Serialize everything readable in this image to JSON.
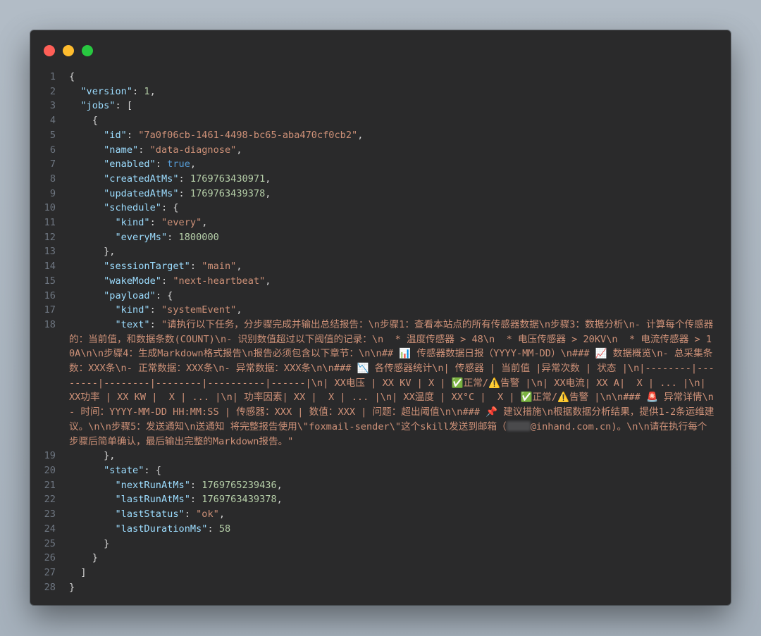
{
  "window": {
    "controls": [
      "close",
      "minimize",
      "zoom"
    ]
  },
  "code": {
    "line_numbers": [
      "1",
      "2",
      "3",
      "4",
      "5",
      "6",
      "7",
      "8",
      "9",
      "10",
      "11",
      "12",
      "13",
      "14",
      "15",
      "16",
      "17",
      "18",
      "19",
      "20",
      "21",
      "22",
      "23",
      "24",
      "25",
      "26",
      "27",
      "28"
    ],
    "keys": {
      "version": "\"version\"",
      "jobs": "\"jobs\"",
      "id": "\"id\"",
      "name": "\"name\"",
      "enabled": "\"enabled\"",
      "createdAtMs": "\"createdAtMs\"",
      "updatedAtMs": "\"updatedAtMs\"",
      "schedule": "\"schedule\"",
      "kind": "\"kind\"",
      "everyMs": "\"everyMs\"",
      "sessionTarget": "\"sessionTarget\"",
      "wakeMode": "\"wakeMode\"",
      "payload": "\"payload\"",
      "text": "\"text\"",
      "state": "\"state\"",
      "nextRunAtMs": "\"nextRunAtMs\"",
      "lastRunAtMs": "\"lastRunAtMs\"",
      "lastStatus": "\"lastStatus\"",
      "lastDurationMs": "\"lastDurationMs\""
    },
    "values": {
      "version": "1",
      "id": "\"7a0f06cb-1461-4498-bc65-aba470cf0cb2\"",
      "name": "\"data-diagnose\"",
      "enabled": "true",
      "createdAtMs": "1769763430971",
      "updatedAtMs": "1769763439378",
      "schedule_kind": "\"every\"",
      "everyMs": "1800000",
      "sessionTarget": "\"main\"",
      "wakeMode": "\"next-heartbeat\"",
      "payload_kind": "\"systemEvent\"",
      "text_part1": "\"请执行以下任务，分步骤完成并输出总结报告：\\n步骤1：查看本站点的所有传感器数据\\n步骤3：数据分析\\n- 计算每个传感器的：当前值，和数据条数(COUNT)\\n- 识别数值超过以下阈值的记录：\\n  * 温度传感器 > 48\\n  * 电压传感器 > 20KV\\n  * 电流传感器 > 10A\\n\\n步骤4：生成Markdown格式报告\\n报告必须包含以下章节：\\n\\n## 📊 传感器数据日报（YYYY-MM-DD）\\n### 📈 数据概览\\n- 总采集条数：XXX条\\n- 正常数据：XXX条\\n- 异常数据：XXX条\\n\\n### 📉 各传感器统计\\n| 传感器 | 当前值 |异常次数 | 状态 |\\n|--------|--------|--------|--------|----------|------|\\n| XX电压 | XX KV | X | ✅正常/⚠️告警 |\\n| XX电流| XX A|  X | ... |\\n| XX功率 | XX KW |  X | ... |\\n| 功率因素| XX |  X | ... |\\n| XX温度 | XX°C |  X | ✅正常/⚠️告警 |\\n\\n### 🚨 异常详情\\n- 时间：YYYY-MM-DD HH:MM:SS | 传感器：XXX | 数值：XXX | 问题：超出阈值\\n\\n### 📌 建议措施\\n根据数据分析结果，提供1-2条运维建议。\\n\\n步骤5：发送通知\\n送通知 将完整报告使用\\\"foxmail-sender\\\"这个skill发送到邮箱（",
      "text_part2": "@inhand.com.cn)。\\n\\n请在执行每个步骤后简单确认，最后输出完整的Markdown报告。\"",
      "nextRunAtMs": "1769765239436",
      "lastRunAtMs": "1769763439378",
      "lastStatus": "\"ok\"",
      "lastDurationMs": "58"
    },
    "colors": {
      "background": "#2a2a2b",
      "key": "#9cdcfe",
      "string": "#ce9178",
      "number": "#b5cea8",
      "boolean": "#569cd6",
      "punctuation": "#d4d4d4",
      "line_number": "#6e7681"
    }
  }
}
